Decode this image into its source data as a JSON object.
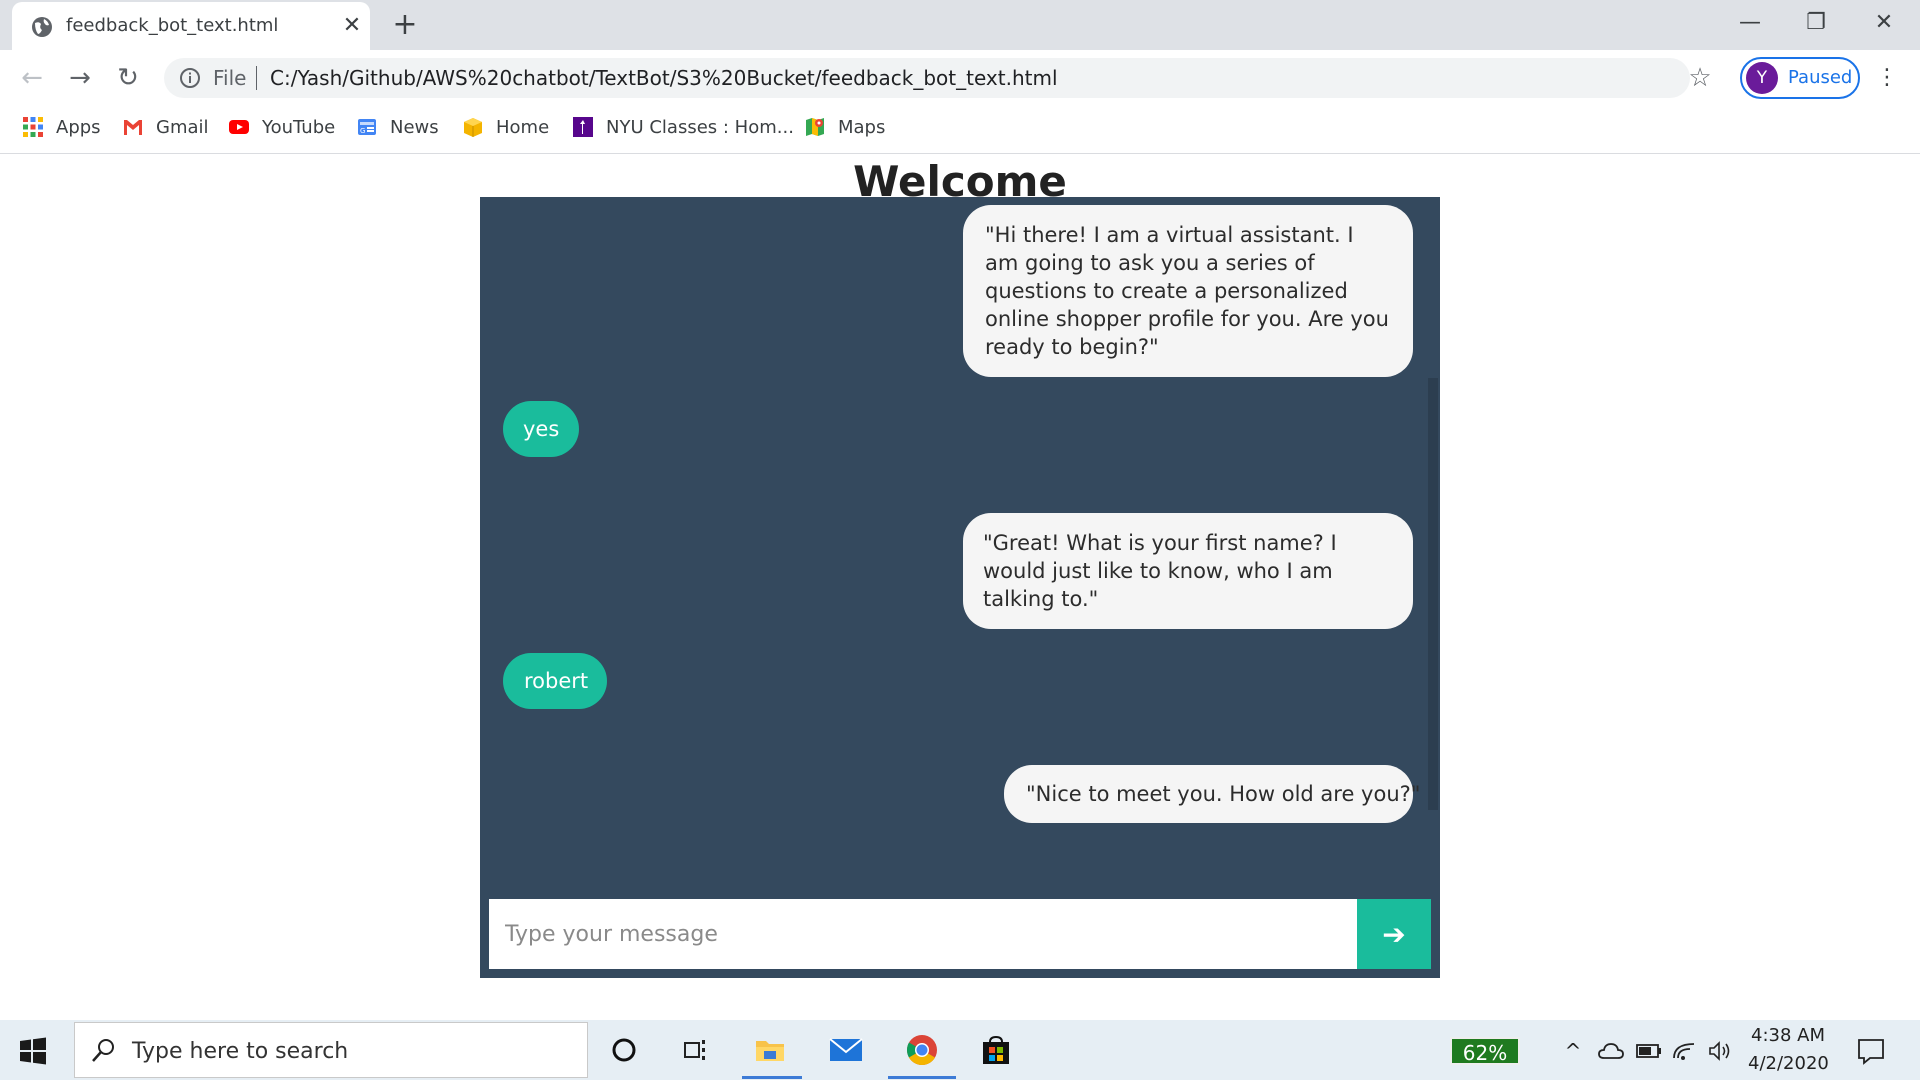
{
  "browser": {
    "tab_title": "feedback_bot_text.html",
    "new_tab_symbol": "+",
    "scheme_label": "File",
    "url": "C:/Yash/Github/AWS%20chatbot/TextBot/S3%20Bucket/feedback_bot_text.html",
    "profile_initial": "Y",
    "profile_status": "Paused",
    "bookmarks": [
      {
        "label": "Apps",
        "icon": "apps-grid-icon"
      },
      {
        "label": "Gmail",
        "icon": "gmail-icon"
      },
      {
        "label": "YouTube",
        "icon": "youtube-icon"
      },
      {
        "label": "News",
        "icon": "google-news-icon"
      },
      {
        "label": "Home",
        "icon": "home-box-icon"
      },
      {
        "label": "NYU Classes : Hom...",
        "icon": "nyu-icon"
      },
      {
        "label": "Maps",
        "icon": "maps-icon"
      }
    ]
  },
  "page": {
    "title": "Welcome",
    "messages": [
      {
        "role": "bot",
        "text": "\"Hi there! I am a virtual assistant. I am going to ask you a series of questions to create a personalized online shopper profile for you. Are you ready to begin?\""
      },
      {
        "role": "user",
        "text": "yes"
      },
      {
        "role": "bot",
        "text": "\"Great! What is your first name? I would just like to know, who I am talking to.\""
      },
      {
        "role": "user",
        "text": "robert"
      },
      {
        "role": "bot",
        "text": "\"Nice to meet you. How old are you?\""
      }
    ],
    "input_placeholder": "Type your message",
    "send_symbol": "➔"
  },
  "taskbar": {
    "search_placeholder": "Type here to search",
    "battery_percent": "62%",
    "time": "4:38 AM",
    "date": "4/2/2020"
  },
  "colors": {
    "chat_panel": "#34495e",
    "user_bubble": "#1abc9c",
    "bot_bubble": "#f5f5f5",
    "send_button": "#1abc9c",
    "profile_accent": "#1a73e8"
  }
}
